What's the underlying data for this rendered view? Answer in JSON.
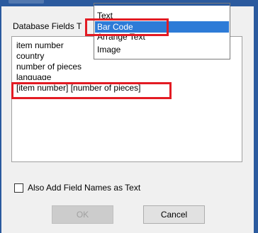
{
  "dialog": {
    "fields_label": "Database Fields T",
    "fields_list": [
      "item number",
      "country",
      "number of pieces",
      "language",
      "[item number] [number of pieces]"
    ],
    "checkbox": {
      "label": "Also Add Field Names as Text",
      "checked": false
    },
    "buttons": {
      "ok": "OK",
      "cancel": "Cancel"
    }
  },
  "dropdown": {
    "items": [
      "Text",
      "Bar Code",
      "Arrange Text",
      "Image"
    ],
    "selected": "Bar Code"
  },
  "colors": {
    "title_bar": "#2b5a9e",
    "selection": "#2d7bd7",
    "annotation": "#e31b23"
  }
}
